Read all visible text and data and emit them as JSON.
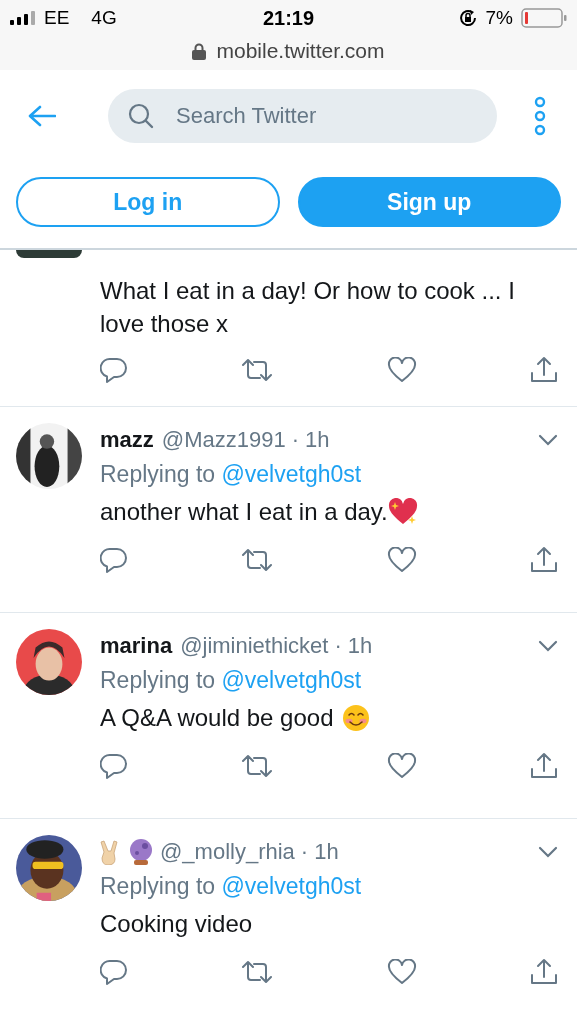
{
  "status_bar": {
    "carrier": "EE",
    "network": "4G",
    "time": "21:19",
    "battery": "7%"
  },
  "address_bar": {
    "url": "mobile.twitter.com"
  },
  "header": {
    "search": {
      "placeholder": "Search Twitter"
    },
    "buttons": [
      {
        "label": "Log in",
        "kind": "outline"
      },
      {
        "label": "Sign up",
        "kind": "filled"
      }
    ]
  },
  "tweets": [
    {
      "kind": "partial",
      "text": "What I eat in a day! Or how to cook ... I love those x"
    },
    {
      "kind": "heart",
      "name": "mazz",
      "handle": "@Mazz1991",
      "time": "· 1h",
      "replying": "Replying to",
      "reply_to": "@velvetgh0st",
      "text": "another what I eat in a day."
    },
    {
      "kind": "smile",
      "name": "marina",
      "handle": "@jiminiethicket",
      "time": "· 1h",
      "replying": "Replying to",
      "reply_to": "@velvetgh0st",
      "text": "A Q&A would be good"
    },
    {
      "kind": "emoji_name",
      "handle": "@_molly_rhia",
      "time": "· 1h",
      "replying": "Replying to",
      "reply_to": "@velvetgh0st",
      "text": "Cooking video"
    }
  ]
}
